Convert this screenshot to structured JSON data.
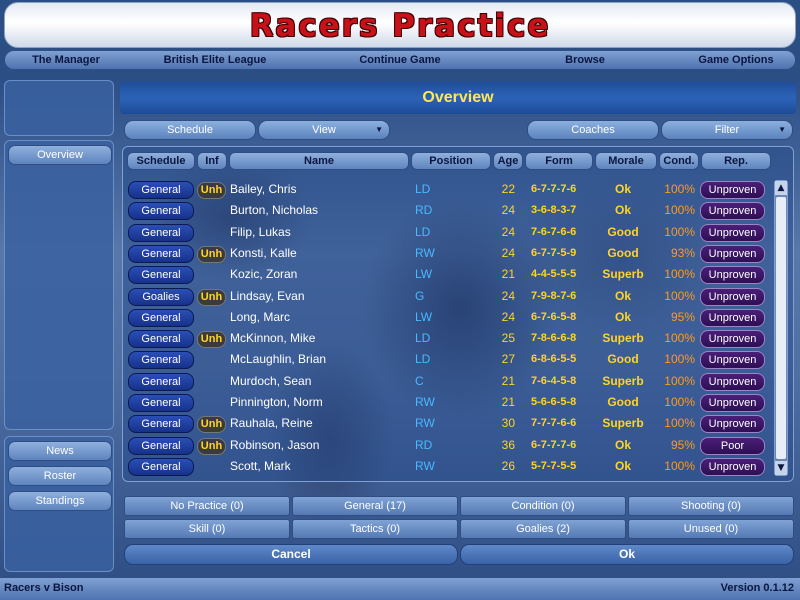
{
  "title": "Racers Practice",
  "nav": [
    "The Manager",
    "British Elite League",
    "Continue Game",
    "Browse",
    "Game Options"
  ],
  "sidebar": {
    "current": "Overview",
    "bottom": [
      "News",
      "Roster",
      "Standings"
    ]
  },
  "header": "Overview",
  "toolbar": {
    "schedule": "Schedule",
    "view": "View",
    "coaches": "Coaches",
    "filter": "Filter"
  },
  "table": {
    "headers": [
      "Schedule",
      "Inf",
      "Name",
      "Position",
      "Age",
      "Form",
      "Morale",
      "Cond.",
      "Rep."
    ],
    "rows": [
      {
        "schedule": "General",
        "inf": "Unh",
        "name": "Bailey, Chris",
        "pos": "LD",
        "age": "22",
        "form": "6-7-7-7-6",
        "morale": "Ok",
        "cond": "100%",
        "rep": "Unproven"
      },
      {
        "schedule": "General",
        "inf": "",
        "name": "Burton, Nicholas",
        "pos": "RD",
        "age": "24",
        "form": "3-6-8-3-7",
        "morale": "Ok",
        "cond": "100%",
        "rep": "Unproven"
      },
      {
        "schedule": "General",
        "inf": "",
        "name": "Filip, Lukas",
        "pos": "LD",
        "age": "24",
        "form": "7-6-7-6-6",
        "morale": "Good",
        "cond": "100%",
        "rep": "Unproven"
      },
      {
        "schedule": "General",
        "inf": "Unh",
        "name": "Konsti, Kalle",
        "pos": "RW",
        "age": "24",
        "form": "6-7-7-5-9",
        "morale": "Good",
        "cond": "93%",
        "rep": "Unproven"
      },
      {
        "schedule": "General",
        "inf": "",
        "name": "Kozic, Zoran",
        "pos": "LW",
        "age": "21",
        "form": "4-4-5-5-5",
        "morale": "Superb",
        "cond": "100%",
        "rep": "Unproven"
      },
      {
        "schedule": "Goalies",
        "inf": "Unh",
        "name": "Lindsay, Evan",
        "pos": "G",
        "age": "24",
        "form": "7-9-8-7-6",
        "morale": "Ok",
        "cond": "100%",
        "rep": "Unproven"
      },
      {
        "schedule": "General",
        "inf": "",
        "name": "Long, Marc",
        "pos": "LW",
        "age": "24",
        "form": "6-7-6-5-8",
        "morale": "Ok",
        "cond": "95%",
        "rep": "Unproven"
      },
      {
        "schedule": "General",
        "inf": "Unh",
        "name": "McKinnon, Mike",
        "pos": "LD",
        "age": "25",
        "form": "7-8-6-6-8",
        "morale": "Superb",
        "cond": "100%",
        "rep": "Unproven"
      },
      {
        "schedule": "General",
        "inf": "",
        "name": "McLaughlin, Brian",
        "pos": "LD",
        "age": "27",
        "form": "6-8-6-5-5",
        "morale": "Good",
        "cond": "100%",
        "rep": "Unproven"
      },
      {
        "schedule": "General",
        "inf": "",
        "name": "Murdoch, Sean",
        "pos": "C",
        "age": "21",
        "form": "7-6-4-5-8",
        "morale": "Superb",
        "cond": "100%",
        "rep": "Unproven"
      },
      {
        "schedule": "General",
        "inf": "",
        "name": "Pinnington, Norm",
        "pos": "RW",
        "age": "21",
        "form": "5-6-6-5-8",
        "morale": "Good",
        "cond": "100%",
        "rep": "Unproven"
      },
      {
        "schedule": "General",
        "inf": "Unh",
        "name": "Rauhala, Reine",
        "pos": "RW",
        "age": "30",
        "form": "7-7-7-6-6",
        "morale": "Superb",
        "cond": "100%",
        "rep": "Unproven"
      },
      {
        "schedule": "General",
        "inf": "Unh",
        "name": "Robinson, Jason",
        "pos": "RD",
        "age": "36",
        "form": "6-7-7-7-6",
        "morale": "Ok",
        "cond": "95%",
        "rep": "Poor"
      },
      {
        "schedule": "General",
        "inf": "",
        "name": "Scott, Mark",
        "pos": "RW",
        "age": "26",
        "form": "5-7-7-5-5",
        "morale": "Ok",
        "cond": "100%",
        "rep": "Unproven"
      }
    ]
  },
  "filters": [
    "No Practice (0)",
    "General (17)",
    "Condition (0)",
    "Shooting (0)",
    "Skill (0)",
    "Tactics (0)",
    "Goalies (2)",
    "Unused (0)"
  ],
  "actions": {
    "cancel": "Cancel",
    "ok": "Ok"
  },
  "status": {
    "left": "Racers v Bison",
    "right": "Version 0.1.12"
  },
  "colors": {
    "title": "#c8121a",
    "header_text": "#ffe65a",
    "age_form_morale": "#ffd428",
    "position": "#48b9ff",
    "condition": "#ff9a1e",
    "rep_badge": "#2f0f55"
  }
}
